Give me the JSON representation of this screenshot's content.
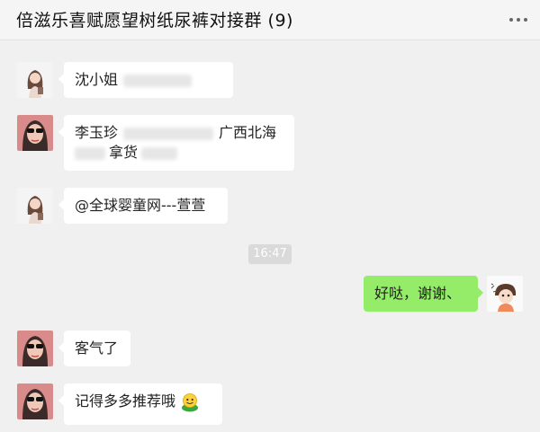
{
  "chat": {
    "title": "倍滋乐喜赋愿望树纸尿裤对接群 (9)",
    "more_icon": "more-dots-icon"
  },
  "messages": [
    {
      "sender": "girl-avatar",
      "text": "沈小姐"
    },
    {
      "sender": "sunglasses-avatar",
      "line1": "李玉珍",
      "line1_end": "广西北海",
      "line2": "拿货"
    },
    {
      "sender": "girl-avatar",
      "text": "@全球婴童网---萱萱"
    },
    {
      "timestamp": "16:47"
    },
    {
      "sender": "self-cartoon-avatar",
      "text": "好哒，谢谢、"
    },
    {
      "sender": "sunglasses-avatar",
      "text": "客气了"
    },
    {
      "sender": "sunglasses-avatar",
      "text": "记得多多推荐哦",
      "emoji": "smiley-icon"
    }
  ],
  "colors": {
    "background": "#f0f0f0",
    "bubble_in": "#ffffff",
    "bubble_out": "#95ec69",
    "timestamp_bg": "#dadada"
  }
}
